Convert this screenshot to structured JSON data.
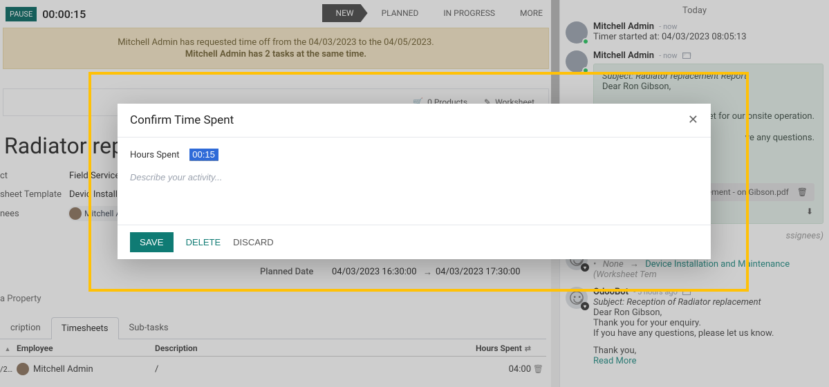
{
  "header": {
    "pause_label": "PAUSE",
    "timer": "00:00:15",
    "stages": {
      "new": "NEW",
      "planned": "PLANNED",
      "in_progress": "IN PROGRESS",
      "more": "MORE"
    }
  },
  "banner": {
    "line1": "Mitchell Admin has requested time off from the 04/03/2023 to the 04/05/2023.",
    "line2": "Mitchell Admin has 2 tasks at the same time."
  },
  "stats": {
    "products": "0 Products",
    "worksheet": "Worksheet"
  },
  "task": {
    "title": "Radiator repla",
    "fields": {
      "project_label": "ct",
      "project_value": "Field Service",
      "template_label": "sheet Template",
      "template_value": "Devic   Installa",
      "assignees_label": "nees",
      "assignee_name": "Mitchell Adm"
    },
    "planned": {
      "label": "Planned Date",
      "start": "04/03/2023 16:30:00",
      "end": "04/03/2023 17:30:00"
    },
    "property_link": "a Property"
  },
  "tabs": {
    "description": "cription",
    "timesheets": "Timesheets",
    "subtasks": "Sub-tasks"
  },
  "timesheet": {
    "head": {
      "employee": "Employee",
      "description": "Description",
      "hours": "Hours Spent"
    },
    "rows": [
      {
        "date": "/2…",
        "employee": "Mitchell Admin",
        "description": "/",
        "hours": "04:00"
      }
    ]
  },
  "side": {
    "today": "Today",
    "messages": [
      {
        "author": "Mitchell Admin",
        "meta": "- now",
        "line": "Timer started at: 04/03/2023 08:05:13"
      }
    ],
    "note": {
      "author": "Mitchell Admin",
      "meta": "- now",
      "subject": "Subject: Radiator replacement Report",
      "greeting": "Dear Ron Gibson,",
      "l1": "eet for our onsite operation.",
      "l2": "ve any questions.",
      "attachment": "cement -   on Gibson.pdf"
    },
    "assignees_trail": "ssignees)",
    "bot1": {
      "author": "OdooBot",
      "meta": "- 5 hours ago",
      "none": "None",
      "link": "Device Installation and Maintenance",
      "trail": "(Worksheet Tem"
    },
    "bot2": {
      "author": "OdooBot",
      "meta": "- 5 hours ago",
      "subject": "Subject: Reception of Radiator replacement",
      "greeting": "Dear Ron Gibson,",
      "l1": "Thank you for your enquiry.",
      "l2": "If you have any questions, please let us know.",
      "l3": "Thank you,",
      "l4": "Read More"
    }
  },
  "modal": {
    "title": "Confirm Time Spent",
    "hours_label": "Hours Spent",
    "hours_value": "00:15",
    "desc_placeholder": "Describe your activity...",
    "save": "SAVE",
    "delete": "DELETE",
    "discard": "DISCARD"
  }
}
